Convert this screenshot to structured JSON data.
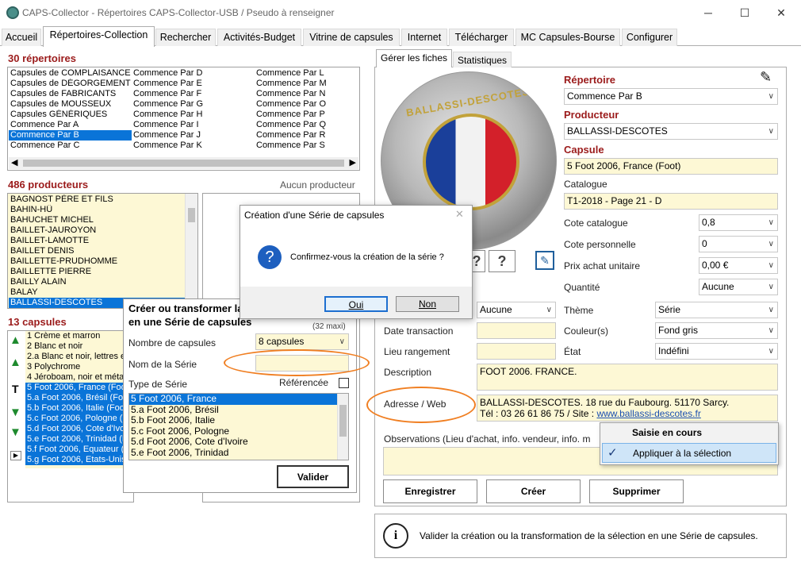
{
  "window": {
    "title": "CAPS-Collector - Répertoires CAPS-Collector-USB / Pseudo à renseigner"
  },
  "tabs": [
    "Accueil",
    "Répertoires-Collection",
    "Rechercher",
    "Activités-Budget",
    "Vitrine de capsules",
    "Internet",
    "Télécharger",
    "MC Capsules-Bourse",
    "Configurer"
  ],
  "repertoires": {
    "header": "30 répertoires",
    "col1": [
      "Capsules de COMPLAISANCE",
      "Capsules de DÉGORGEMENT",
      "Capsules de FABRICANTS",
      "Capsules de MOUSSEUX",
      "Capsules GÉNÉRIQUES",
      "Commence Par A",
      "Commence Par B",
      "Commence Par C"
    ],
    "col2": [
      "Commence Par D",
      "Commence Par E",
      "Commence Par F",
      "Commence Par G",
      "Commence Par H",
      "Commence Par I",
      "Commence Par J",
      "Commence Par K"
    ],
    "col3": [
      "Commence Par L",
      "Commence Par M",
      "Commence Par N",
      "Commence Par O",
      "Commence Par P",
      "Commence Par Q",
      "Commence Par R",
      "Commence Par S"
    ]
  },
  "producteurs": {
    "header": "486 producteurs",
    "right_label": "Aucun producteur",
    "items": [
      "BAGNOST PÈRE ET FILS",
      "BAHIN-HÛ",
      "BAHUCHET MICHEL",
      "BAILLET-JAUROYON",
      "BAILLET-LAMOTTE",
      "BAILLET DENIS",
      "BAILLETTE-PRUDHOMME",
      "BAILLETTE PIERRE",
      "BAILLY ALAIN",
      "BALAY",
      "BALLASSI-DESCOTES"
    ]
  },
  "capsules": {
    "header": "13 capsules",
    "items": [
      "1 Crème et marron",
      "2 Blanc et noir",
      "2.a Blanc et noir, lettres et...",
      "3 Polychrome",
      "4 Jéroboam, noir et méta...",
      "5 Foot 2006, France (Foot)",
      "5.a Foot 2006, Brésil (Foo...",
      "5.b Foot 2006, Italie (Foot)",
      "5.c Foot 2006, Pologne (Fo...",
      "5.d Foot 2006, Cote d'Ivo...",
      "5.e Foot 2006, Trinidad (F...",
      "5.f Foot 2006, Equateur (F...",
      "5.g Foot 2006, Etats-Unis..."
    ],
    "side_letter": "T"
  },
  "serie_panel": {
    "title_line1": "Créer ou transformer la",
    "title_line2": "en une Série de capsules",
    "maxi": "(32 maxi)",
    "nb_label": "Nombre de capsules",
    "nb_value": "8 capsules",
    "nom_label": "Nom de la Série",
    "nom_value": "",
    "type_label": "Type de Série",
    "ref_label": "Référencée",
    "list": [
      "5 Foot 2006, France",
      "5.a Foot 2006, Brésil",
      "5.b Foot 2006, Italie",
      "5.c Foot 2006, Pologne",
      "5.d Foot 2006, Cote d'Ivoire",
      "5.e Foot 2006, Trinidad"
    ],
    "valider": "Valider"
  },
  "confirm": {
    "title": "Création d'une Série de capsules",
    "message": "Confirmez-vous la création de la série ?",
    "oui": "Oui",
    "non": "Non"
  },
  "right": {
    "subtabs": [
      "Gérer les fiches",
      "Statistiques"
    ],
    "cap_text": "BALLASSI-DESCOTES",
    "repertoire_label": "Répertoire",
    "repertoire_value": "Commence Par B",
    "producteur_label": "Producteur",
    "producteur_value": "BALLASSI-DESCOTES",
    "capsule_label": "Capsule",
    "capsule_value": "5 Foot 2006, France (Foot)",
    "catalogue_label": "Catalogue",
    "catalogue_value": "T1-2018 - Page 21 - D",
    "cote_cat_label": "Cote catalogue",
    "cote_cat_value": "0,8",
    "cote_perso_label": "Cote personnelle",
    "cote_perso_value": "0",
    "prix_label": "Prix achat unitaire",
    "prix_value": "0,00 €",
    "quantite_label": "Quantité",
    "quantite_value": "Aucune",
    "aucune_value": "Aucune",
    "theme_label": "Thème",
    "theme_value": "Série",
    "date_label": "Date transaction",
    "couleur_label": "Couleur(s)",
    "couleur_value": "Fond gris",
    "lieu_label": "Lieu rangement",
    "etat_label": "État",
    "etat_value": "Indéfini",
    "desc_label": "Description",
    "desc_value": "FOOT 2006. FRANCE.",
    "adresse_label": "Adresse / Web",
    "adresse_line1": "BALLASSI-DESCOTES. 18 rue du Faubourg. 51170 Sarcy.",
    "adresse_line2": "Tél : 03 26 61 86 75 / Site : ",
    "adresse_link": "www.ballassi-descotes.fr",
    "obs_label": "Observations (Lieu d'achat, info. vendeur, info. m",
    "btn_enregistrer": "Enregistrer",
    "btn_creer": "Créer",
    "btn_supprimer": "Supprimer",
    "info_text": "Valider la création ou la transformation de la sélection en une Série de capsules."
  },
  "context_menu": {
    "header": "Saisie en cours",
    "item": "Appliquer à la sélection"
  },
  "colors": {
    "accent": "#0a74d8",
    "header_red": "#9b1b1b",
    "field_yellow": "#fdf8d5",
    "highlight_orange": "#f07f22"
  }
}
